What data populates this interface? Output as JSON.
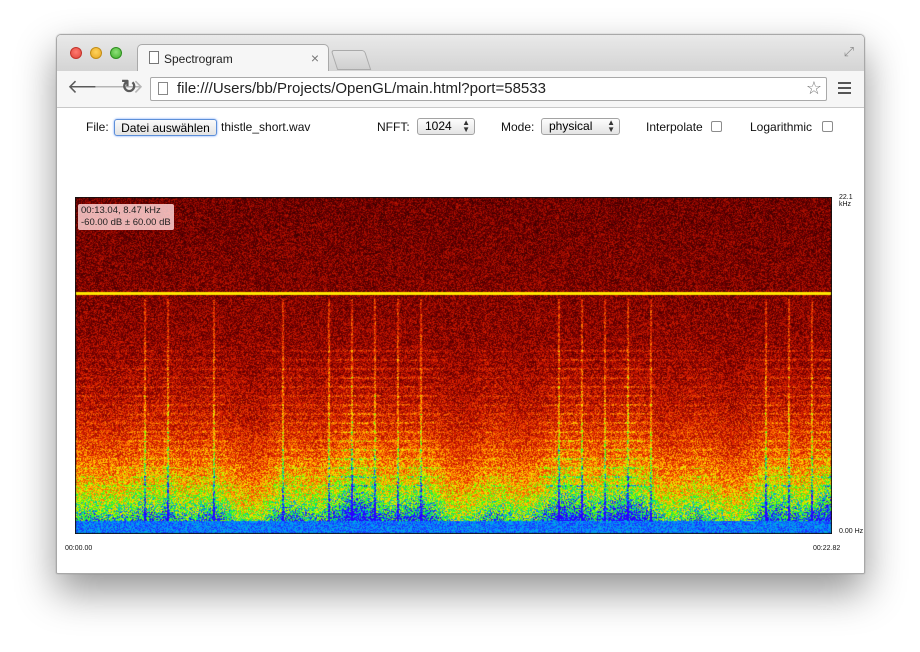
{
  "browser": {
    "tab_title": "Spectrogram",
    "tab_close": "×",
    "url": "file:///Users/bb/Projects/OpenGL/main.html?port=58533"
  },
  "controls": {
    "file_label": "File:",
    "file_button": "Datei auswählen",
    "file_name": "thistle_short.wav",
    "nfft_label": "NFFT:",
    "nfft_value": "1024",
    "mode_label": "Mode:",
    "mode_value": "physical",
    "interpolate_label": "Interpolate",
    "interpolate_checked": false,
    "logarithmic_label": "Logarithmic",
    "logarithmic_checked": false
  },
  "spectrogram": {
    "info_time_freq": "00:13.04, 8.47 kHz",
    "info_db": "-60.00 dB ± 60.00 dB",
    "y_top_label": "22.1 kHz",
    "y_bottom_label": "0.00 Hz",
    "x_start_label": "00:00.00",
    "x_end_label": "00:22.82",
    "colors": {
      "low": "#1a00ff",
      "mid": "#00ff00",
      "high": "#ff3000",
      "bg": "#7a0000"
    }
  }
}
